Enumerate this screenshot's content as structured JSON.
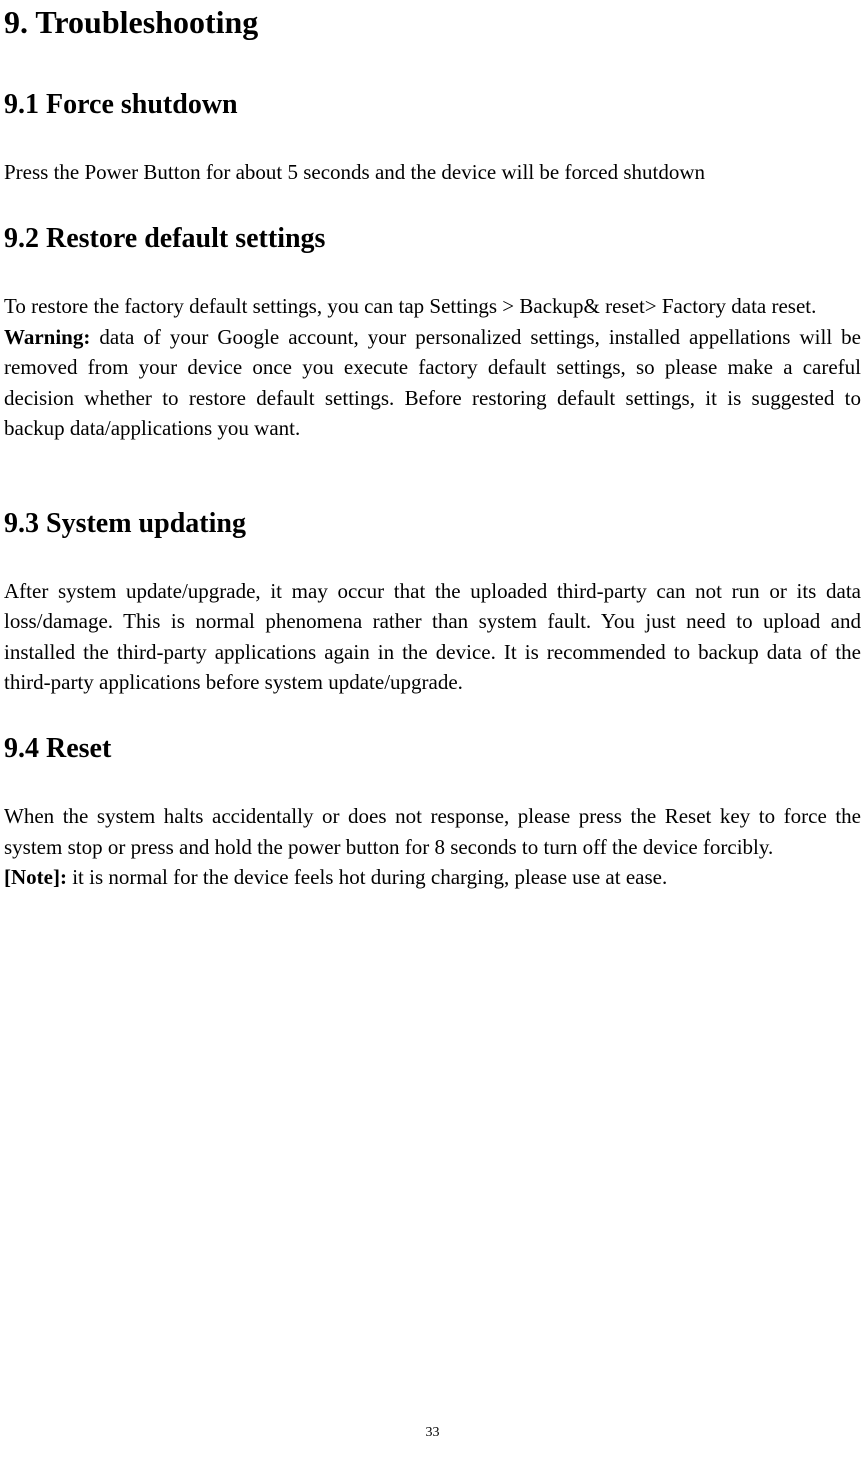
{
  "chapter_title": "9. Troubleshooting",
  "sections": {
    "s91": {
      "heading": "9.1 Force shutdown",
      "body": "Press the Power Button for about 5 seconds and the device will be forced shutdown"
    },
    "s92": {
      "heading": "9.2 Restore default settings",
      "body_intro": "To restore the factory default settings, you can tap Settings > Backup& reset> Factory data reset.",
      "warning_label": "Warning:",
      "warning_text": " data of your Google account, your personalized settings, installed appellations will be removed from your device once you execute factory default settings, so please make a careful decision whether to restore default settings. Before restoring default settings, it is suggested to backup data/applications you want."
    },
    "s93": {
      "heading": "9.3 System updating",
      "body": "After system update/upgrade, it may occur that the uploaded third-party can not run or its data loss/damage. This is normal phenomena rather than system fault. You just need to upload and installed the third-party applications again in the device. It is recommended to backup data of the third-party applications before system update/upgrade."
    },
    "s94": {
      "heading": "9.4 Reset",
      "body_main": "When the system halts accidentally or does not response, please press the Reset key to force the system stop or press and hold the power button for 8 seconds to turn off the device forcibly.",
      "note_label": "[Note]:",
      "note_text": " it is normal for the device feels hot during charging, please use at ease."
    }
  },
  "page_number": "33"
}
